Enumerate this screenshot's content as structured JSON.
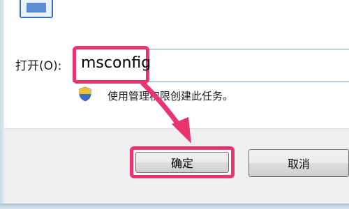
{
  "dialog": {
    "open_label": "打开(O):",
    "open_value": "msconfig",
    "admin_note": "使用管理权限创建此任务。",
    "ok_label": "确定",
    "cancel_label": "取消"
  },
  "icons": {
    "run": "run-dialog-icon",
    "shield": "uac-shield-icon"
  },
  "colors": {
    "highlight": "#e8356d",
    "accent": "#3a6fb3"
  }
}
